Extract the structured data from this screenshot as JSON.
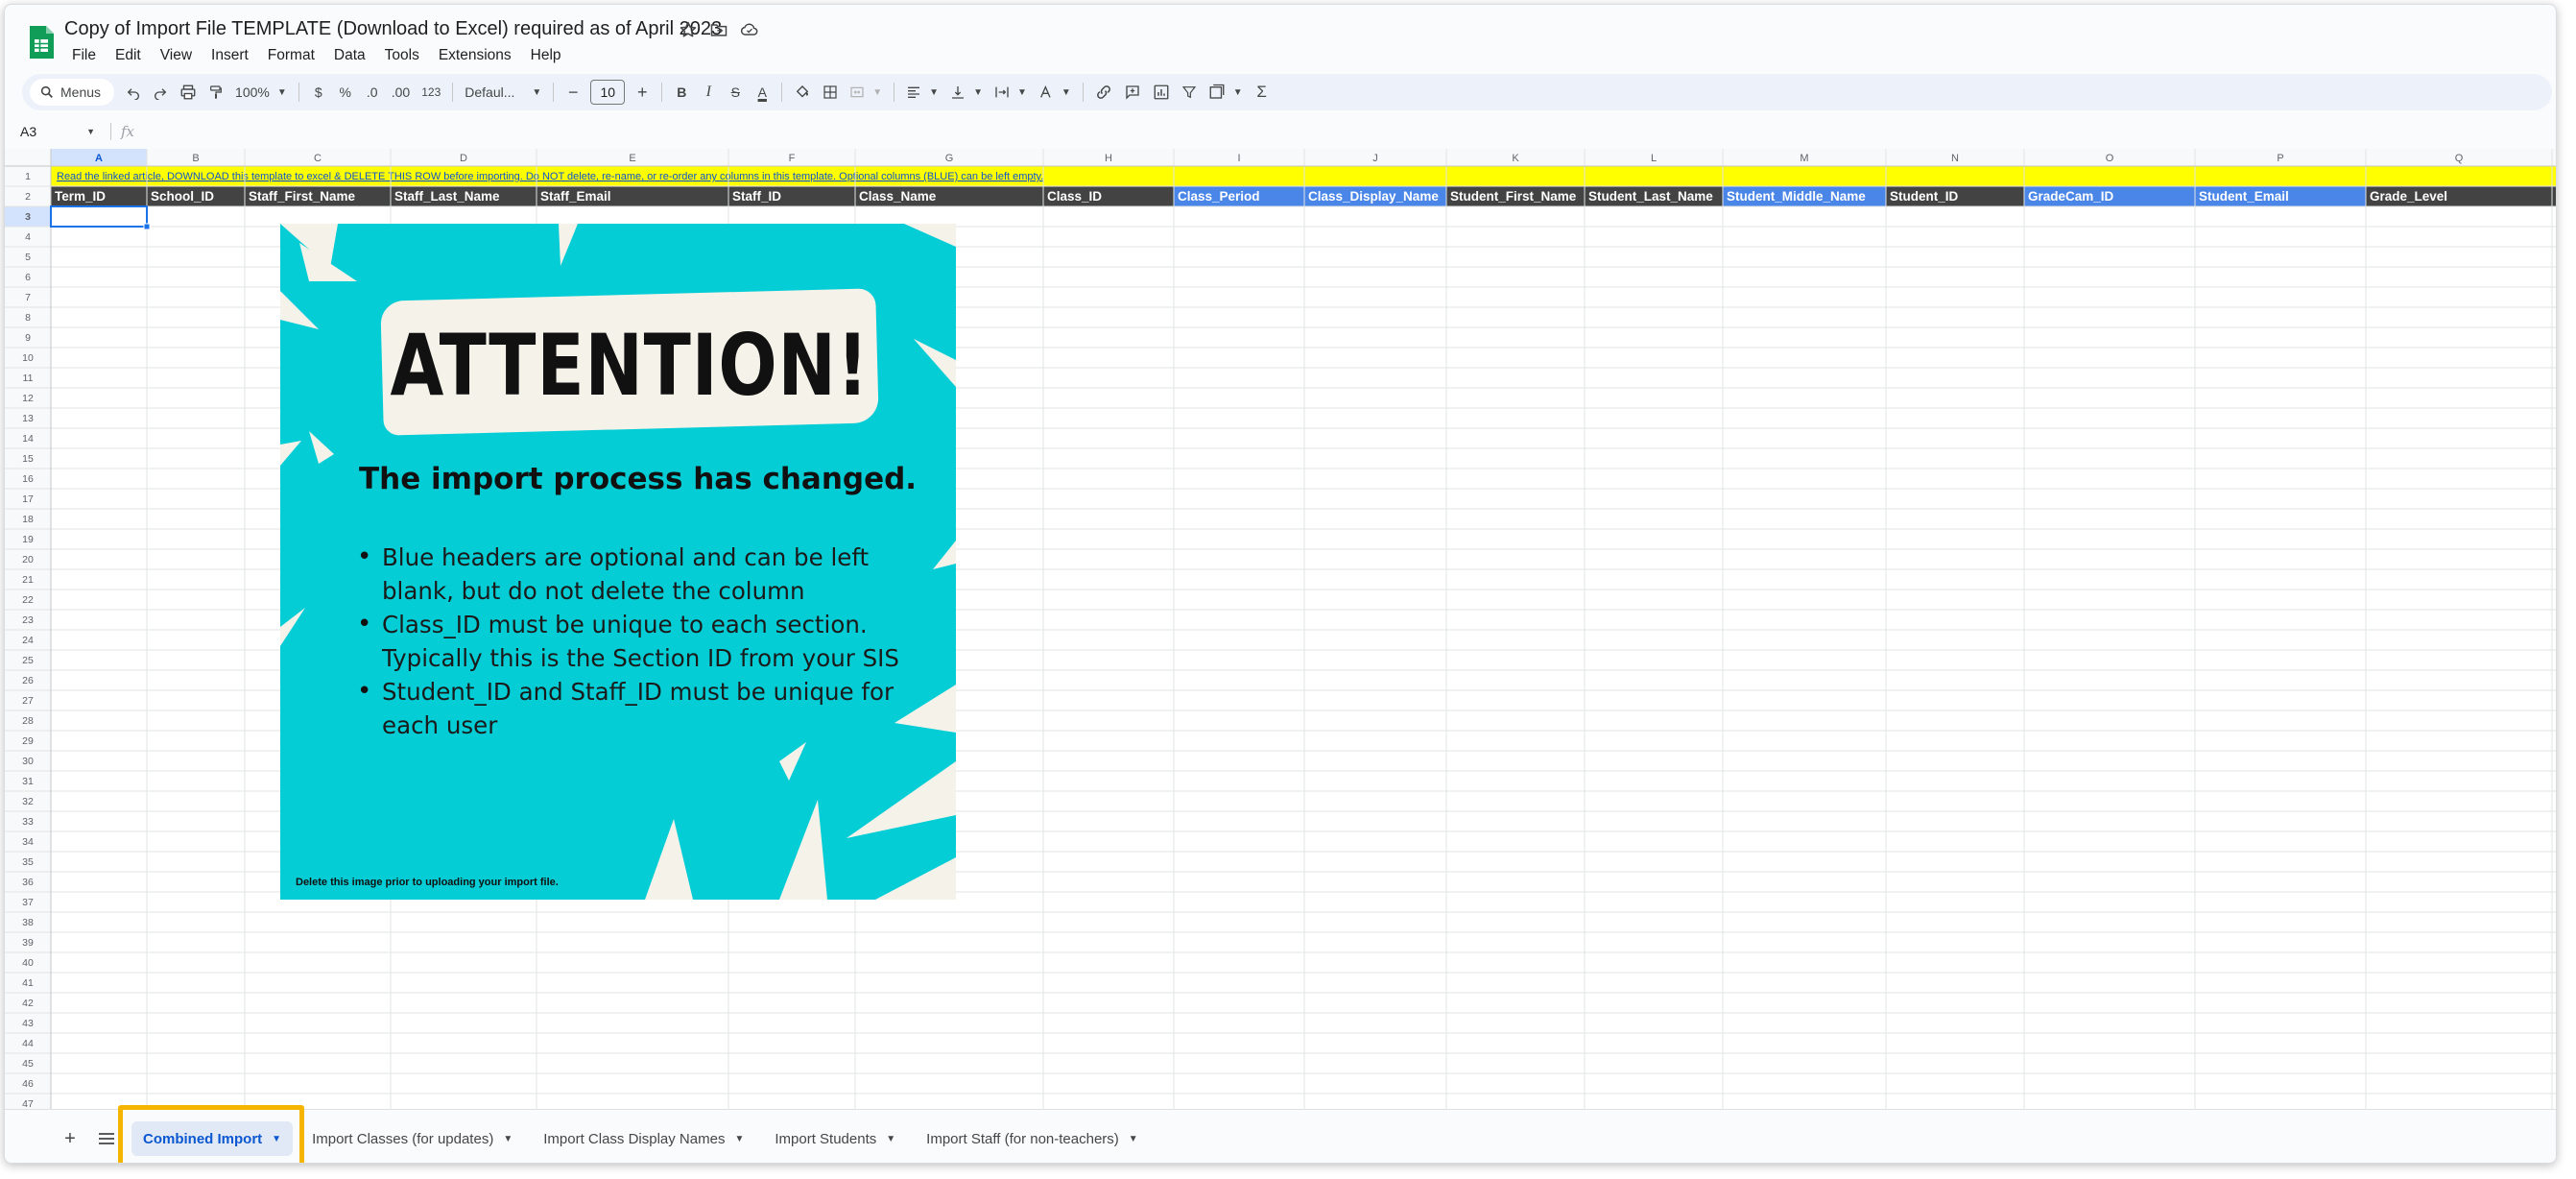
{
  "doc": {
    "title": "Copy of Import File TEMPLATE (Download to Excel) required as of April 2023"
  },
  "menu": [
    "File",
    "Edit",
    "View",
    "Insert",
    "Format",
    "Data",
    "Tools",
    "Extensions",
    "Help"
  ],
  "toolbar": {
    "menus_search": "Menus",
    "zoom": "100%",
    "currency": "$",
    "percent": "%",
    "decrease_decimal": ".0",
    "increase_decimal": ".00",
    "number_format": "123",
    "font": "Defaul...",
    "font_size": "10",
    "bold": "B",
    "italic": "I",
    "strike": "S",
    "text_color": "A",
    "sum": "Σ"
  },
  "formula_bar": {
    "cell_ref": "A3",
    "fx": "fx",
    "value": ""
  },
  "grid": {
    "columns": [
      "A",
      "B",
      "C",
      "D",
      "E",
      "F",
      "G",
      "H",
      "I",
      "J",
      "K",
      "L",
      "M",
      "N",
      "O",
      "P",
      "Q"
    ],
    "row_count": 47,
    "selected_cell": "A3",
    "row1_note": "Read the linked article, DOWNLOAD this template to excel & DELETE THIS ROW before importing. Do NOT delete, re-name, or re-order any columns in this template. Optional columns (BLUE) can be left empty.",
    "headers": [
      {
        "col": "A",
        "label": "Term_ID",
        "optional": false
      },
      {
        "col": "B",
        "label": "School_ID",
        "optional": false
      },
      {
        "col": "C",
        "label": "Staff_First_Name",
        "optional": false
      },
      {
        "col": "D",
        "label": "Staff_Last_Name",
        "optional": false
      },
      {
        "col": "E",
        "label": "Staff_Email",
        "optional": false
      },
      {
        "col": "F",
        "label": "Staff_ID",
        "optional": false
      },
      {
        "col": "G",
        "label": "Class_Name",
        "optional": false
      },
      {
        "col": "H",
        "label": "Class_ID",
        "optional": false
      },
      {
        "col": "I",
        "label": "Class_Period",
        "optional": true
      },
      {
        "col": "J",
        "label": "Class_Display_Name",
        "optional": true
      },
      {
        "col": "K",
        "label": "Student_First_Name",
        "optional": false
      },
      {
        "col": "L",
        "label": "Student_Last_Name",
        "optional": false
      },
      {
        "col": "M",
        "label": "Student_Middle_Name",
        "optional": true
      },
      {
        "col": "N",
        "label": "Student_ID",
        "optional": false
      },
      {
        "col": "O",
        "label": "GradeCam_ID",
        "optional": true
      },
      {
        "col": "P",
        "label": "Student_Email",
        "optional": true
      },
      {
        "col": "Q",
        "label": "Grade_Level",
        "optional": false
      }
    ],
    "colors": {
      "note_row": "#ffff00",
      "header_dark": "#434343",
      "header_optional": "#4a86e8",
      "selection": "#1a73e8"
    }
  },
  "attention_image": {
    "title": "ATTENTION!",
    "subtitle": "The import process has changed.",
    "bullets": [
      "Blue headers are optional and can be left blank, but do not delete the column",
      "Class_ID must be unique to each section. Typically this is the Section ID from your SIS",
      "Student_ID and Staff_ID must be unique for each user"
    ],
    "footnote": "Delete this image prior to uploading your import file.",
    "background": "#05cdd5"
  },
  "sheets": {
    "tabs": [
      {
        "label": "Combined Import",
        "active": true
      },
      {
        "label": "Import Classes (for updates)",
        "active": false
      },
      {
        "label": "Import Class Display Names",
        "active": false
      },
      {
        "label": "Import Students",
        "active": false
      },
      {
        "label": "Import Staff (for non-teachers)",
        "active": false
      }
    ]
  }
}
